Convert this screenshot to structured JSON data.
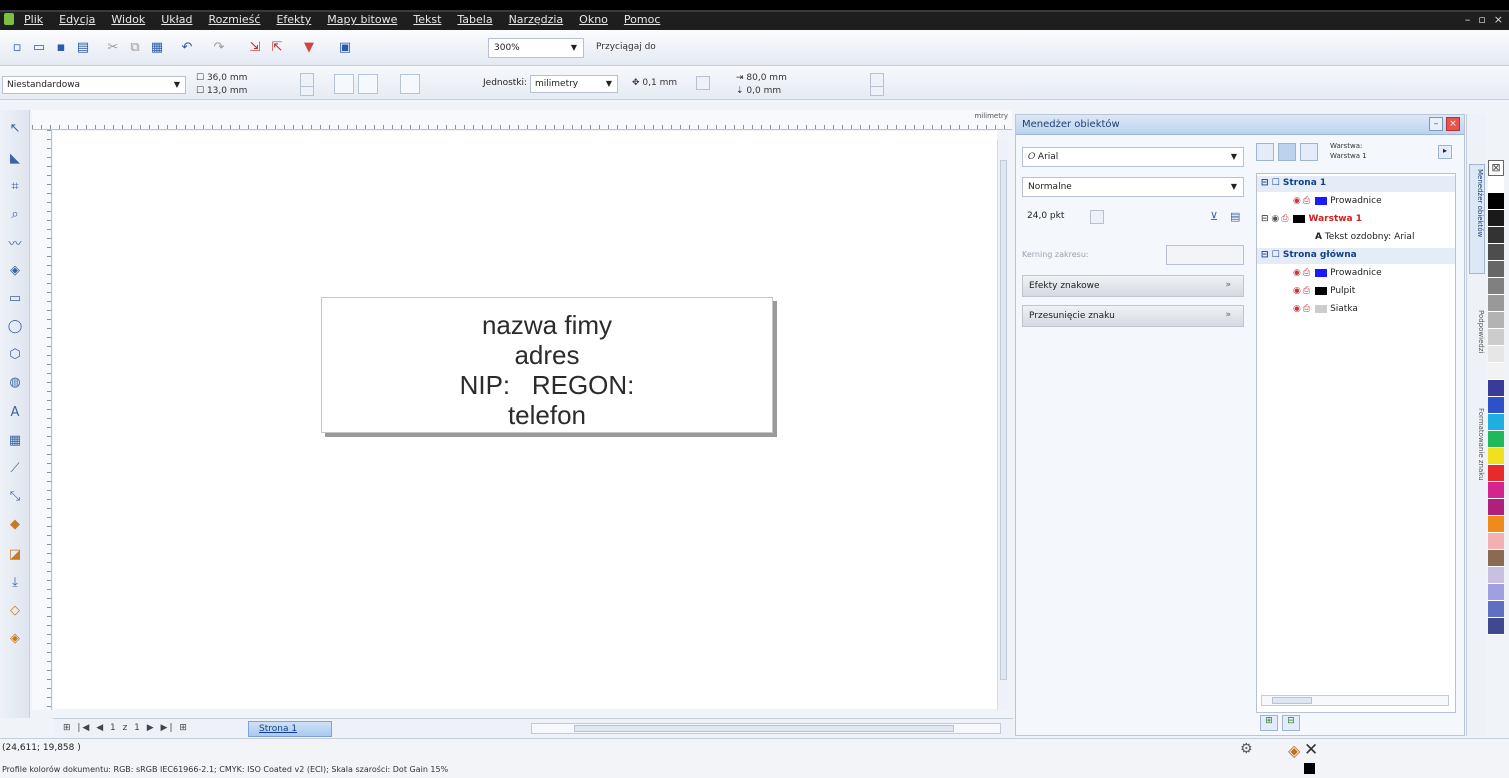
{
  "menubar": {
    "items": [
      "Plik",
      "Edycja",
      "Widok",
      "Układ",
      "Rozmieść",
      "Efekty",
      "Mapy bitowe",
      "Tekst",
      "Tabela",
      "Narzędzia",
      "Okno",
      "Pomoc"
    ],
    "window_controls": [
      "–",
      "▫",
      "×"
    ]
  },
  "standard_toolbar": {
    "zoom": "300%",
    "snap_label": "Przyciągaj do"
  },
  "property_bar": {
    "paper_size": "Niestandardowa",
    "width": "36,0 mm",
    "height": "13,0 mm",
    "units_label": "Jednostki:",
    "units_value": "milimetry",
    "nudge": "0,1 mm",
    "dup_x": "80,0 mm",
    "dup_y": "0,0 mm"
  },
  "ruler": {
    "unit": "milimetry"
  },
  "canvas": {
    "label_lines": [
      "nazwa fimy",
      "adres",
      "NIP:   REGON:",
      "telefon"
    ]
  },
  "page_bar": {
    "nav": "1 z 1",
    "page_tab": "Strona 1"
  },
  "status": {
    "coords": "(24,611; 19,858 )",
    "profiles": "Profile kolorów dokumentu: RGB: sRGB IEC61966-2.1; CMYK: ISO Coated v2 (ECI); Skala szarości: Dot Gain 15%"
  },
  "docker": {
    "title": "Menedżer obiektów",
    "font_name": "Arial",
    "font_style": "Normalne",
    "font_size": "24,0 pkt",
    "kerning_label": "Kerning zakresu:",
    "fx_sections": [
      "Efekty znakowe",
      "Przesunięcie znaku"
    ],
    "layer_label_title": "Warstwa:",
    "layer_label_value": "Warstwa 1",
    "tree": [
      {
        "kind": "page",
        "text": "Strona 1"
      },
      {
        "kind": "layer",
        "text": "Prowadnice",
        "color": "#1a1aff"
      },
      {
        "kind": "layer-active",
        "text": "Warstwa 1",
        "color": "#000000"
      },
      {
        "kind": "object",
        "text": "Tekst ozdobny: Arial"
      },
      {
        "kind": "page",
        "text": "Strona główna"
      },
      {
        "kind": "layer",
        "text": "Prowadnice",
        "color": "#1a1aff"
      },
      {
        "kind": "layer",
        "text": "Pulpit",
        "color": "#000000"
      },
      {
        "kind": "layer",
        "text": "Siatka",
        "color": "#cccccc"
      }
    ]
  },
  "vertical_tabs": [
    "Menedżer obiektów",
    "Podpowiedzi",
    "Formatowanie znaku"
  ],
  "palette": [
    "#ffffff",
    "#000000",
    "#1a1a1a",
    "#333333",
    "#4d4d4d",
    "#666666",
    "#808080",
    "#999999",
    "#b3b3b3",
    "#cccccc",
    "#e6e6e6",
    "#f2f2f2",
    "#3a3a9a",
    "#2d52c8",
    "#1faee0",
    "#1fb85a",
    "#f0e020",
    "#e82a2a",
    "#d6248e",
    "#b0207a",
    "#f08a1a",
    "#f4b0b0",
    "#8a6a50",
    "#c8c0e0",
    "#a0a0e0",
    "#6070c0",
    "#404890"
  ]
}
